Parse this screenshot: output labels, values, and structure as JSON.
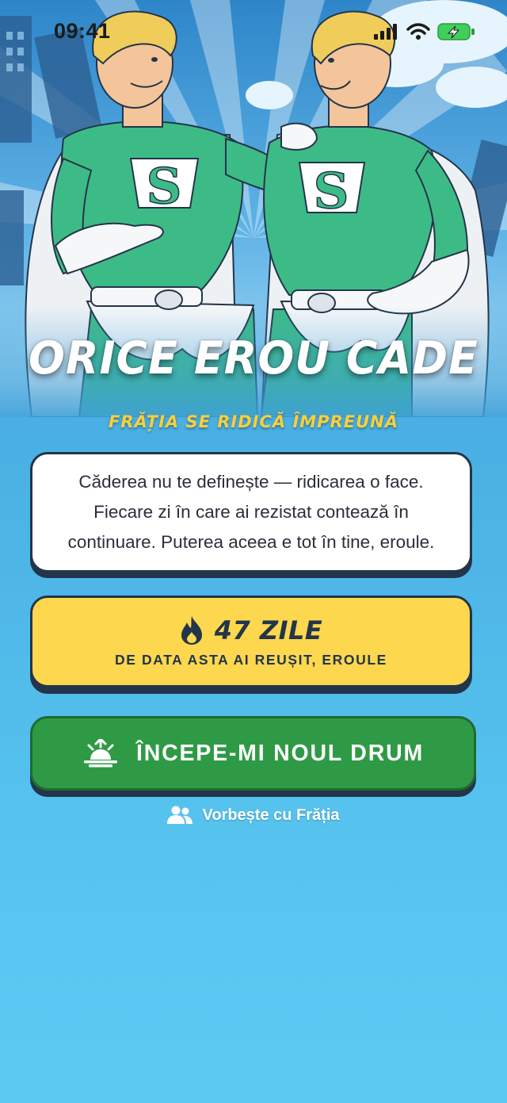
{
  "status_bar": {
    "time": "09:41",
    "icons": [
      "cellular-signal-icon",
      "wifi-icon",
      "battery-charging-icon"
    ]
  },
  "hero": {
    "title": "ORICE EROU CADE",
    "subtitle": "FRĂȚIA SE RIDICĂ ÎMPREUNĂ",
    "illustration": "two-superheroes-green-suits-illustration",
    "emblem_letter": "S"
  },
  "quote": {
    "text": "Căderea nu te definește — ridicarea o face. Fiecare zi în care ai rezistat contează în continuare. Puterea aceea e tot în tine, eroule."
  },
  "streak": {
    "icon": "flame-icon",
    "count_label": "47 ZILE",
    "subtitle": "DE DATA ASTA AI REUȘIT, EROULE"
  },
  "cta": {
    "icon": "sunrise-icon",
    "label": "ÎNCEPE-MI NOUL DRUM"
  },
  "community": {
    "icon": "users-icon",
    "label": "Vorbește cu Frăția"
  },
  "colors": {
    "background_top": "#3f9fd8",
    "background_bottom": "#5ccbf3",
    "title_yellow": "#f8cf3c",
    "streak_card": "#fdd74e",
    "cta_green": "#2f9a45",
    "outline_navy": "#23354a",
    "suit_green": "#3dbb86"
  }
}
